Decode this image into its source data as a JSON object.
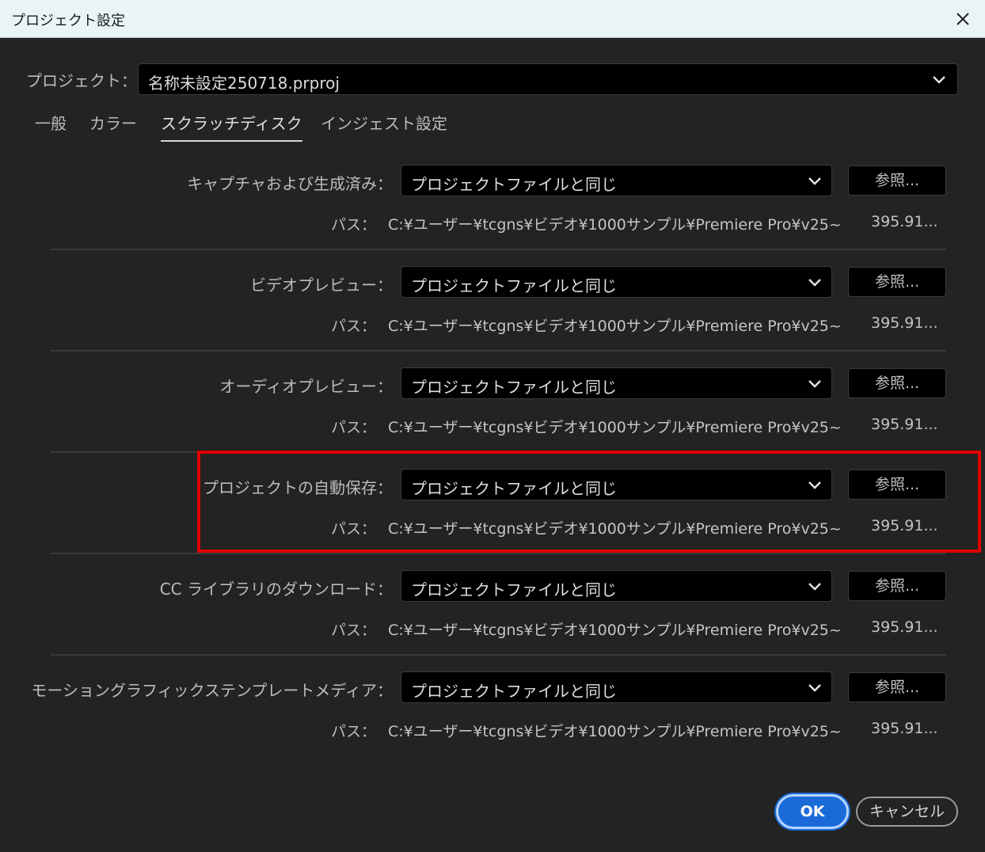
{
  "window": {
    "title": "プロジェクト設定"
  },
  "project": {
    "label": "プロジェクト：",
    "value": "名称未設定250718.prproj"
  },
  "tabs": [
    {
      "label": "一般"
    },
    {
      "label": "カラー"
    },
    {
      "label": "スクラッチディスク",
      "active": true
    },
    {
      "label": "インジェスト設定"
    }
  ],
  "rows": [
    {
      "label": "キャプチャおよび生成済み：",
      "dropdown": "プロジェクトファイルと同じ",
      "browse": "参照...",
      "path_label": "パス：",
      "path": "C:¥ユーザー¥tcgns¥ビデオ¥1000サンプル¥Premiere Pro¥v25~",
      "size": "395.91..."
    },
    {
      "label": "ビデオプレビュー：",
      "dropdown": "プロジェクトファイルと同じ",
      "browse": "参照...",
      "path_label": "パス：",
      "path": "C:¥ユーザー¥tcgns¥ビデオ¥1000サンプル¥Premiere Pro¥v25~",
      "size": "395.91..."
    },
    {
      "label": "オーディオプレビュー：",
      "dropdown": "プロジェクトファイルと同じ",
      "browse": "参照...",
      "path_label": "パス：",
      "path": "C:¥ユーザー¥tcgns¥ビデオ¥1000サンプル¥Premiere Pro¥v25~",
      "size": "395.91..."
    },
    {
      "label": "プロジェクトの自動保存：",
      "dropdown": "プロジェクトファイルと同じ",
      "browse": "参照...",
      "path_label": "パス：",
      "path": "C:¥ユーザー¥tcgns¥ビデオ¥1000サンプル¥Premiere Pro¥v25~",
      "size": "395.91..."
    },
    {
      "label": "CC ライブラリのダウンロード：",
      "dropdown": "プロジェクトファイルと同じ",
      "browse": "参照...",
      "path_label": "パス：",
      "path": "C:¥ユーザー¥tcgns¥ビデオ¥1000サンプル¥Premiere Pro¥v25~",
      "size": "395.91..."
    },
    {
      "label": "モーショングラフィックステンプレートメディア：",
      "dropdown": "プロジェクトファイルと同じ",
      "browse": "参照...",
      "path_label": "パス：",
      "path": "C:¥ユーザー¥tcgns¥ビデオ¥1000サンプル¥Premiere Pro¥v25~",
      "size": "395.91..."
    }
  ],
  "footer": {
    "ok": "OK",
    "cancel": "キャンセル"
  },
  "colors": {
    "highlight": "#e00000",
    "accent": "#1a6bd8",
    "background": "#232323"
  }
}
